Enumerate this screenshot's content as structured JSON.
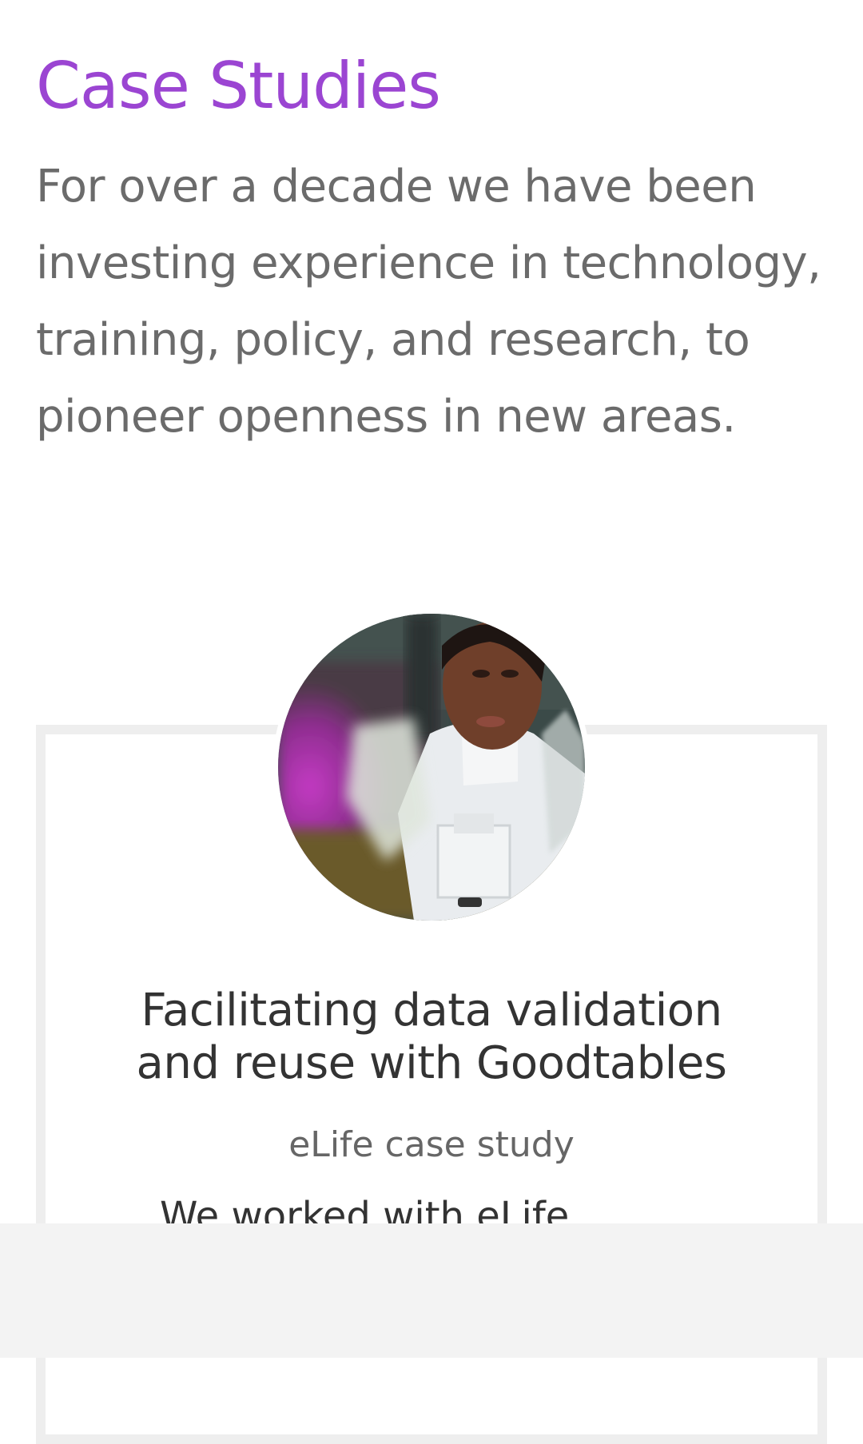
{
  "page": {
    "title": "Case Studies",
    "intro": "For over a decade we have been investing experience in technology, training, policy, and research, to pioneer openness in new areas."
  },
  "case_study": {
    "image_alt": "Woman scientist at a microscope",
    "title": "Facilitating data validation and reuse with Goodtables",
    "subtitle": "eLife case study",
    "excerpt_partial": "We worked with eLife"
  },
  "colors": {
    "title": "#9b45d2",
    "body_text": "#6b6b6b",
    "card_border": "#eeeeee",
    "bottom_bar": "#f3f3f3"
  }
}
